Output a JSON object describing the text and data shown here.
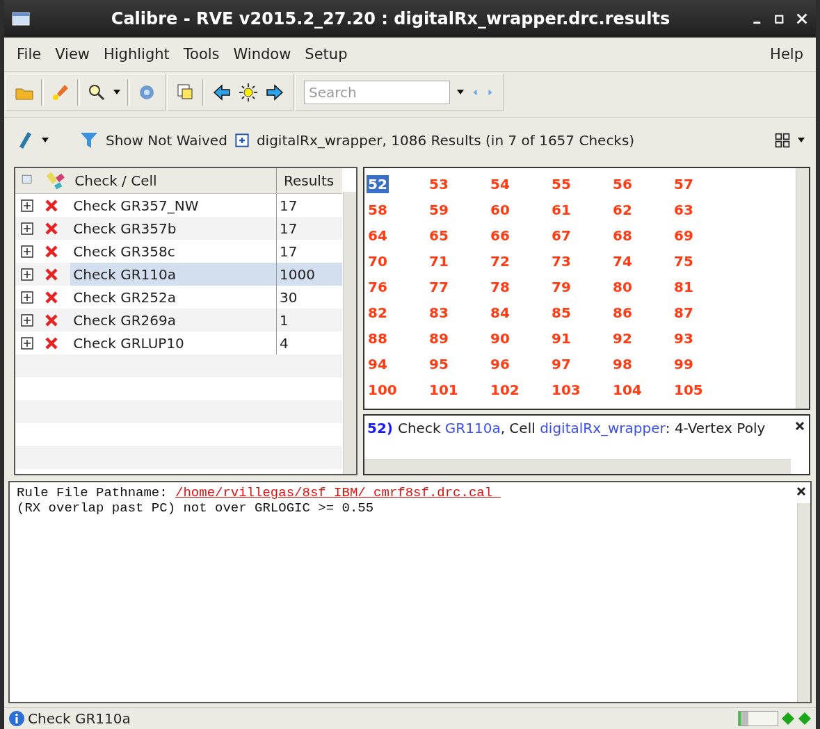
{
  "window": {
    "title": "Calibre - RVE v2015.2_27.20 : digitalRx_wrapper.drc.results"
  },
  "menu": [
    "File",
    "View",
    "Highlight",
    "Tools",
    "Window",
    "Setup"
  ],
  "help_menu": "Help",
  "toolbar": {
    "search": {
      "placeholder": "Search"
    }
  },
  "filter_bar": {
    "filter": "Show Not Waived",
    "summary": "digitalRx_wrapper, 1086 Results (in 7 of 1657 Checks)"
  },
  "checks": {
    "columns": [
      "Check / Cell",
      "Results"
    ],
    "rows": [
      {
        "name": "Check GR357_NW",
        "results": "17",
        "selected": false
      },
      {
        "name": "Check GR357b",
        "results": "17",
        "selected": false
      },
      {
        "name": "Check GR358c",
        "results": "17",
        "selected": false
      },
      {
        "name": "Check GR110a",
        "results": "1000",
        "selected": true
      },
      {
        "name": "Check GR252a",
        "results": "30",
        "selected": false
      },
      {
        "name": "Check GR269a",
        "results": "1",
        "selected": false
      },
      {
        "name": "Check GRLUP10",
        "results": "4",
        "selected": false
      }
    ]
  },
  "results": [
    {
      "label": "52",
      "selected": true
    },
    {
      "label": "53",
      "selected": false
    },
    {
      "label": "54",
      "selected": false
    },
    {
      "label": "55",
      "selected": false
    },
    {
      "label": "56",
      "selected": false
    },
    {
      "label": "57",
      "selected": false
    },
    {
      "label": "58",
      "selected": false
    },
    {
      "label": "59",
      "selected": false
    },
    {
      "label": "60",
      "selected": false
    },
    {
      "label": "61",
      "selected": false
    },
    {
      "label": "62",
      "selected": false
    },
    {
      "label": "63",
      "selected": false
    },
    {
      "label": "64",
      "selected": false
    },
    {
      "label": "65",
      "selected": false
    },
    {
      "label": "66",
      "selected": false
    },
    {
      "label": "67",
      "selected": false
    },
    {
      "label": "68",
      "selected": false
    },
    {
      "label": "69",
      "selected": false
    },
    {
      "label": "70",
      "selected": false
    },
    {
      "label": "71",
      "selected": false
    },
    {
      "label": "72",
      "selected": false
    },
    {
      "label": "73",
      "selected": false
    },
    {
      "label": "74",
      "selected": false
    },
    {
      "label": "75",
      "selected": false
    },
    {
      "label": "76",
      "selected": false
    },
    {
      "label": "77",
      "selected": false
    },
    {
      "label": "78",
      "selected": false
    },
    {
      "label": "79",
      "selected": false
    },
    {
      "label": "80",
      "selected": false
    },
    {
      "label": "81",
      "selected": false
    },
    {
      "label": "82",
      "selected": false
    },
    {
      "label": "83",
      "selected": false
    },
    {
      "label": "84",
      "selected": false
    },
    {
      "label": "85",
      "selected": false
    },
    {
      "label": "86",
      "selected": false
    },
    {
      "label": "87",
      "selected": false
    },
    {
      "label": "88",
      "selected": false
    },
    {
      "label": "89",
      "selected": false
    },
    {
      "label": "90",
      "selected": false
    },
    {
      "label": "91",
      "selected": false
    },
    {
      "label": "92",
      "selected": false
    },
    {
      "label": "93",
      "selected": false
    },
    {
      "label": "94",
      "selected": false
    },
    {
      "label": "95",
      "selected": false
    },
    {
      "label": "96",
      "selected": false
    },
    {
      "label": "97",
      "selected": false
    },
    {
      "label": "98",
      "selected": false
    },
    {
      "label": "99",
      "selected": false
    },
    {
      "label": "100",
      "selected": false
    },
    {
      "label": "101",
      "selected": false
    },
    {
      "label": "102",
      "selected": false
    },
    {
      "label": "103",
      "selected": false
    },
    {
      "label": "104",
      "selected": false
    },
    {
      "label": "105",
      "selected": false
    }
  ],
  "detail": [
    {
      "kind": "index",
      "text": "52) "
    },
    {
      "kind": "plain",
      "text": "Check "
    },
    {
      "kind": "link",
      "text": "GR110a"
    },
    {
      "kind": "plain",
      "text": ", Cell "
    },
    {
      "kind": "link",
      "text": "digitalRx_wrapper"
    },
    {
      "kind": "plain",
      "text": ": 4-Vertex Poly"
    }
  ],
  "rule_text": {
    "label": "Rule File Pathname:",
    "path": "/home/rvillegas/8sf_IBM/_cmrf8sf.drc.cal_",
    "lines": [
      "(RX overlap past PC) not over GRLOGIC >= 0.55"
    ]
  },
  "status_bar": {
    "message": "Check GR110a",
    "progress": {
      "level": 0.25
    }
  }
}
